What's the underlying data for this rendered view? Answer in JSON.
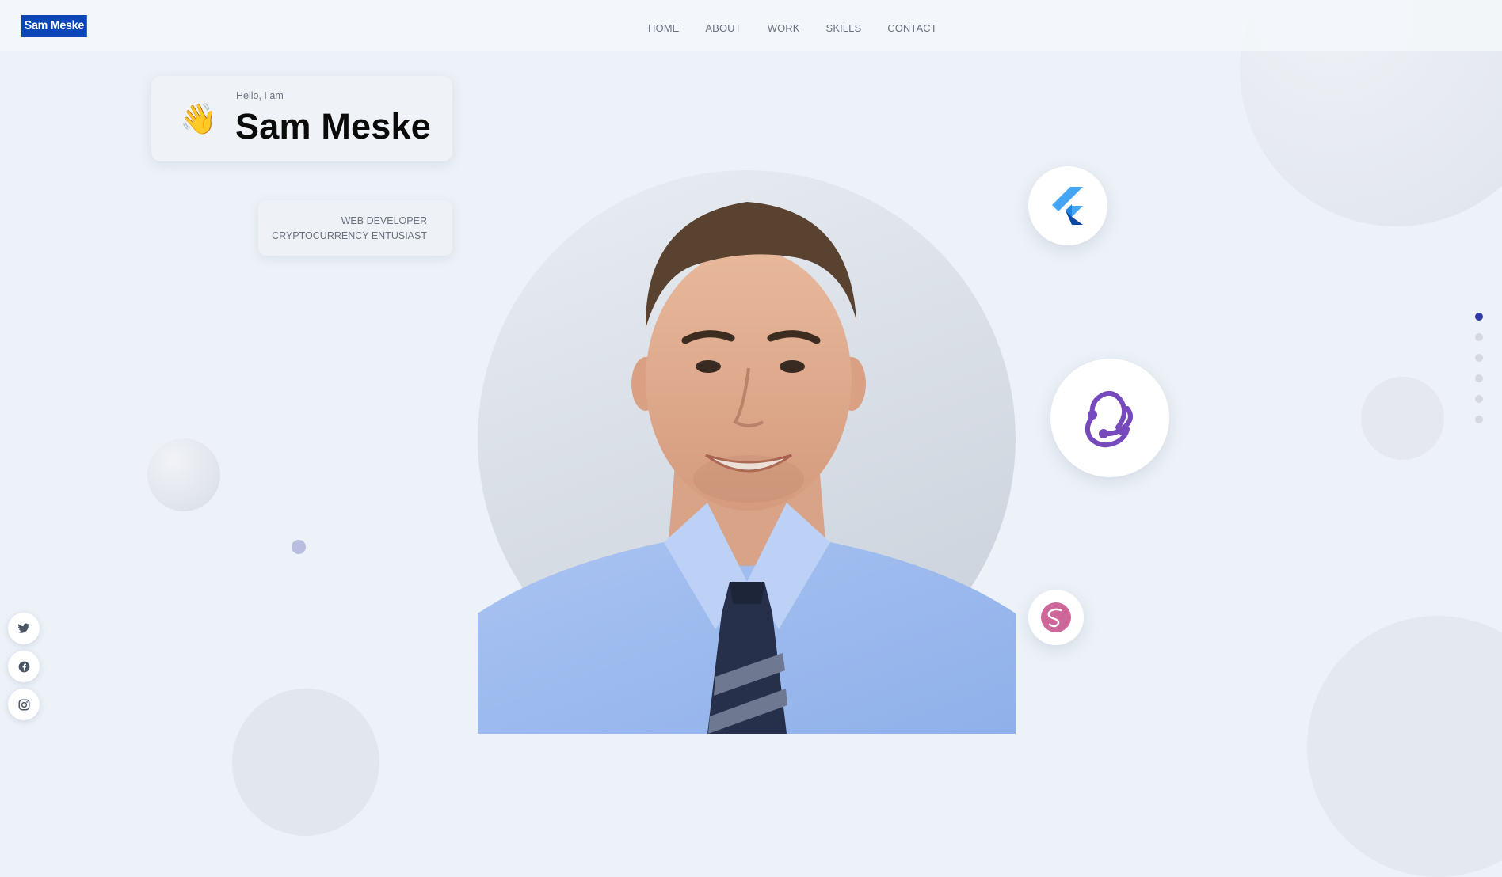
{
  "brand": {
    "logo_text": "Sam Meske"
  },
  "nav": {
    "items": [
      {
        "label": "HOME"
      },
      {
        "label": "ABOUT"
      },
      {
        "label": "WORK"
      },
      {
        "label": "SKILLS"
      },
      {
        "label": "CONTACT"
      }
    ]
  },
  "hero": {
    "greeting": "Hello, I am",
    "name": "Sam Meske",
    "wave_emoji": "👋",
    "roles": [
      "WEB DEVELOPER",
      "CRYPTOCURRENCY ENTUSIAST"
    ]
  },
  "tech_icons": [
    "flutter-icon",
    "redux-icon",
    "sass-icon"
  ],
  "section_dots": {
    "count": 6,
    "active_index": 0
  },
  "social_icons": [
    "twitter-icon",
    "facebook-icon",
    "instagram-icon"
  ],
  "colors": {
    "brand_blue": "#0a46b5",
    "page_background": "#edf2f8",
    "active_dot": "#2f3ba3",
    "redux_purple": "#764abc",
    "sass_pink": "#cd6799",
    "flutter_blue": "#42a5f5"
  }
}
